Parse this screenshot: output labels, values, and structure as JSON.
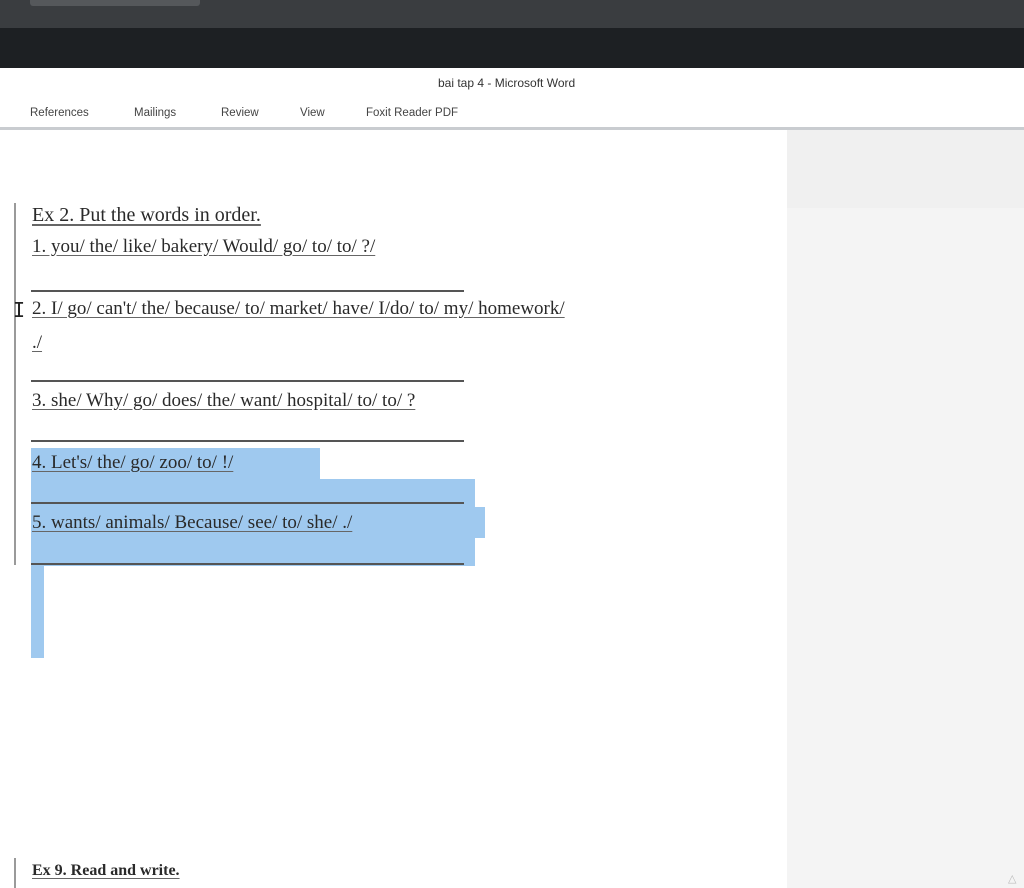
{
  "window": {
    "title": "bai tap 4 - Microsoft Word"
  },
  "ribbon": {
    "tabs": [
      "References",
      "Mailings",
      "Review",
      "View",
      "Foxit Reader PDF"
    ]
  },
  "document": {
    "ex2_heading": "Ex 2. Put the words in order.",
    "items": [
      "1. you/ the/ like/ bakery/ Would/ go/ to/ to/ ?/",
      "2. I/ go/ can't/ the/ because/ to/ market/ have/ I/do/ to/ my/ homework/",
      "./",
      "3. she/ Why/ go/ does/ the/ want/ hospital/ to/ to/ ?",
      "4. Let's/ the/ go/ zoo/ to/ !/",
      "5. wants/ animals/ Because/ see/ to/ she/ ./"
    ],
    "ex9_heading": "Ex 9. Read and write."
  },
  "colors": {
    "selection": "#9fc9ef",
    "title_bar": "#1d2023",
    "page": "#ffffff",
    "side_panel": "#f4f4f4"
  },
  "icons": {
    "text_cursor": "ibeam-cursor-icon"
  }
}
